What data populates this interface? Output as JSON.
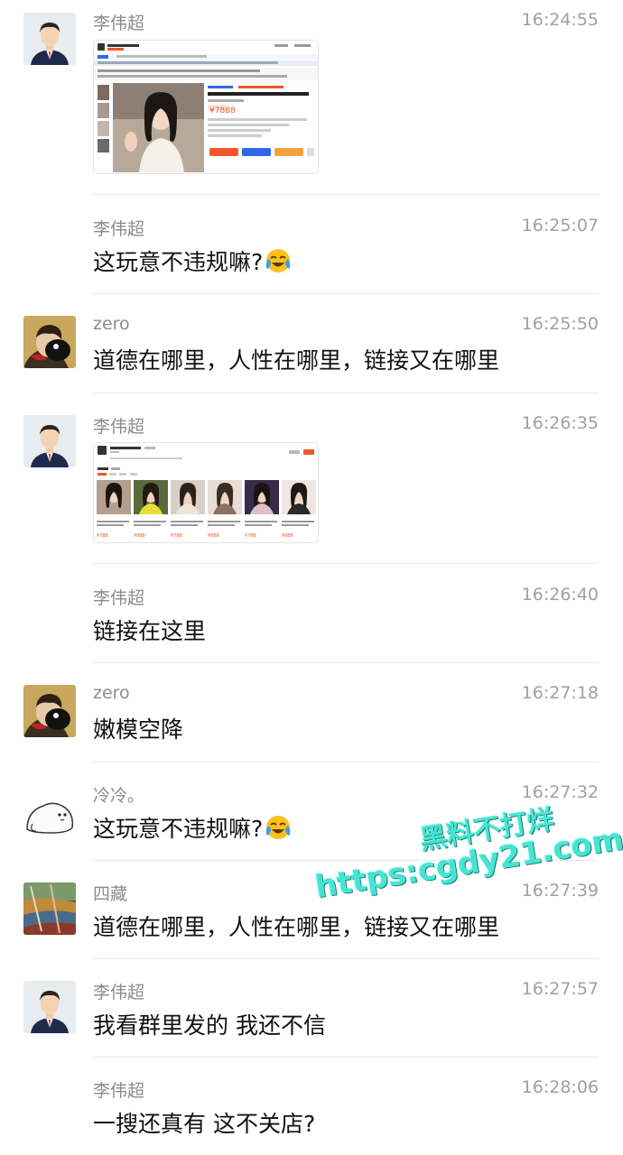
{
  "messages": [
    {
      "sender": "李伟超",
      "time": "16:24:55",
      "avatar": "man-portrait",
      "content_type": "image",
      "image_desc": "product-page-screenshot"
    },
    {
      "sender": "李伟超",
      "time": "16:25:07",
      "text": "这玩意不违规嘛?",
      "emoji": "tears-of-joy-emoji"
    },
    {
      "sender": "zero",
      "time": "16:25:50",
      "avatar": "dark-sticker",
      "text": "道德在哪里，人性在哪里，链接又在哪里"
    },
    {
      "sender": "李伟超",
      "time": "16:26:35",
      "avatar": "man-portrait",
      "content_type": "image",
      "image_desc": "shop-listing-screenshot"
    },
    {
      "sender": "李伟超",
      "time": "16:26:40",
      "text": "链接在这里"
    },
    {
      "sender": "zero",
      "time": "16:27:18",
      "avatar": "dark-sticker",
      "text": "嫩模空降"
    },
    {
      "sender": "冷冷。",
      "time": "16:27:32",
      "avatar": "white-seal",
      "text": "这玩意不违规嘛?",
      "emoji": "tears-of-joy-emoji"
    },
    {
      "sender": "四藏",
      "time": "16:27:39",
      "avatar": "painting",
      "text": "道德在哪里，人性在哪里，链接又在哪里"
    },
    {
      "sender": "李伟超",
      "time": "16:27:57",
      "avatar": "man-portrait",
      "text": "我看群里发的 我还不信"
    },
    {
      "sender": "李伟超",
      "time": "16:28:06",
      "text": "一搜还真有 这不关店?"
    }
  ],
  "shot1": {
    "price": "¥7888"
  },
  "shot2": {
    "prices": [
      "¥788",
      "¥888",
      "¥788",
      "¥888",
      "¥788",
      "¥888"
    ]
  },
  "watermark": {
    "line1": "黑料不打烊",
    "line2": "https:cgdy21.com"
  },
  "colors": {
    "accent_orange": "#f1562a",
    "accent_blue": "#2d6ae8",
    "watermark": "#48e4d3"
  }
}
